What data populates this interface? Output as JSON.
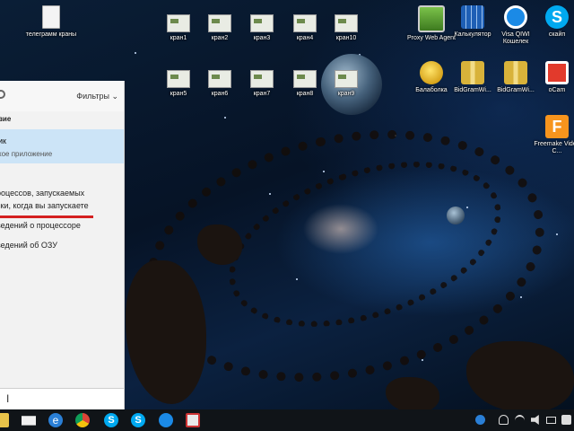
{
  "desktop": {
    "left_icons": [
      {
        "label": "телеграмм краны",
        "icon": "document-icon"
      }
    ],
    "icons": [
      {
        "label": "кран1"
      },
      {
        "label": "кран2"
      },
      {
        "label": "кран3"
      },
      {
        "label": "кран4"
      },
      {
        "label": "кран10"
      },
      {
        "label": "кран5"
      },
      {
        "label": "кран6"
      },
      {
        "label": "кран7"
      },
      {
        "label": "кран8"
      },
      {
        "label": "кран9"
      }
    ],
    "apps": [
      {
        "label": "Proxy Web Agent",
        "icon": "monitor-icon"
      },
      {
        "label": "Калькулятор",
        "icon": "calculator-icon"
      },
      {
        "label": "Visa QIWI Кошелек",
        "icon": "qiwi-icon"
      },
      {
        "label": "скайп",
        "icon": "skype-icon"
      },
      {
        "label": "Балаболка",
        "icon": "smiley-icon"
      },
      {
        "label": "BidGramWi...",
        "icon": "archive-icon"
      },
      {
        "label": "BidGramWi...",
        "icon": "archive-icon"
      },
      {
        "label": "oCam",
        "icon": "camera-icon"
      },
      {
        "label": "Freemake Video C...",
        "icon": "freemake-icon"
      }
    ]
  },
  "search_panel": {
    "filters_label": "Фильтры",
    "section_label": "вие",
    "best_match_title": "ик",
    "best_match_subtitle": "кое приложение",
    "suggestions": [
      "роцессов, запускаемых",
      "ски, когда вы запускаете",
      "ведений о процессоре",
      "ведений об ОЗУ"
    ],
    "input_cursor": "I"
  },
  "taskbar": {
    "apps": [
      "folder-icon",
      "mail-icon",
      "edge-icon",
      "chrome-icon",
      "skype-icon",
      "skype-icon",
      "qiwi-icon",
      "app-icon"
    ],
    "tray": [
      "help-icon",
      "people-icon",
      "network-icon",
      "volume-icon",
      "keyboard-icon",
      "notification-icon"
    ]
  },
  "colors": {
    "selection": "#cce4f7",
    "underline": "#d42020",
    "taskbar": "#101418"
  }
}
